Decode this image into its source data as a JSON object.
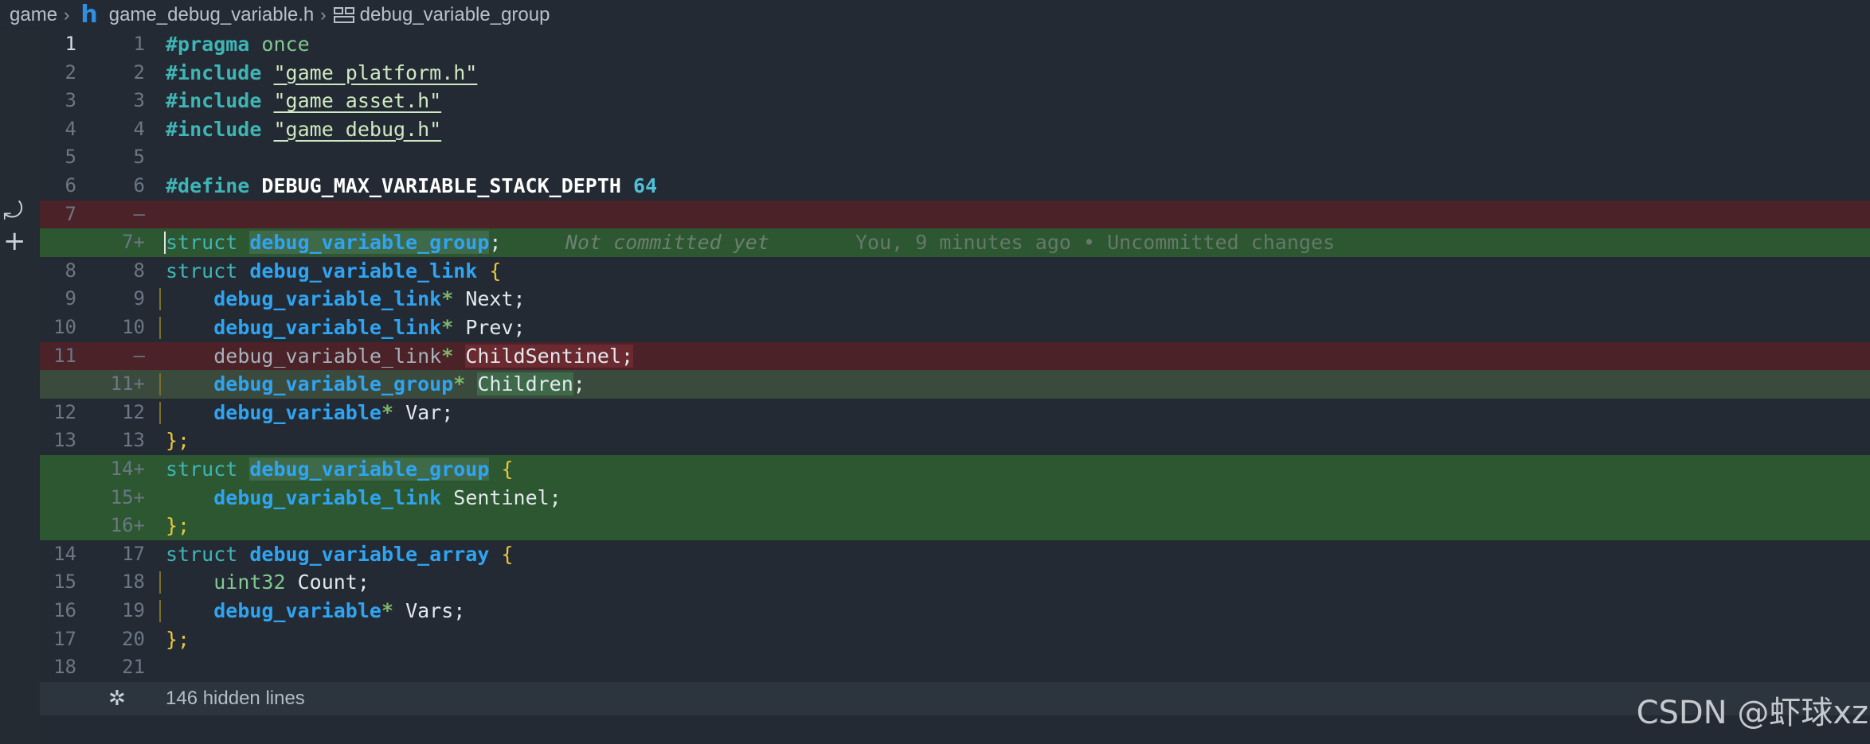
{
  "breadcrumb": {
    "root": "game",
    "file": "game_debug_variable.h",
    "symbol": "debug_variable_group",
    "file_icon": "h-file-icon",
    "symbol_icon": "struct-icon"
  },
  "activity": {
    "icons": [
      "revert-icon",
      "add-icon"
    ]
  },
  "editor": {
    "lines": [
      {
        "old": "1",
        "new": "1",
        "kind": "normal",
        "active": true
      },
      {
        "old": "2",
        "new": "2",
        "kind": "normal"
      },
      {
        "old": "3",
        "new": "3",
        "kind": "normal"
      },
      {
        "old": "4",
        "new": "4",
        "kind": "normal"
      },
      {
        "old": "5",
        "new": "5",
        "kind": "normal"
      },
      {
        "old": "6",
        "new": "6",
        "kind": "normal"
      },
      {
        "old": "7",
        "new": "—",
        "kind": "del"
      },
      {
        "old": "",
        "new": "7+",
        "kind": "add"
      },
      {
        "old": "8",
        "new": "8",
        "kind": "normal"
      },
      {
        "old": "9",
        "new": "9",
        "kind": "normal"
      },
      {
        "old": "10",
        "new": "10",
        "kind": "normal"
      },
      {
        "old": "11",
        "new": "—",
        "kind": "del"
      },
      {
        "old": "",
        "new": "11+",
        "kind": "addsoft"
      },
      {
        "old": "12",
        "new": "12",
        "kind": "normal"
      },
      {
        "old": "13",
        "new": "13",
        "kind": "normal"
      },
      {
        "old": "",
        "new": "14+",
        "kind": "add"
      },
      {
        "old": "",
        "new": "15+",
        "kind": "add"
      },
      {
        "old": "",
        "new": "16+",
        "kind": "add"
      },
      {
        "old": "14",
        "new": "17",
        "kind": "normal"
      },
      {
        "old": "15",
        "new": "18",
        "kind": "normal"
      },
      {
        "old": "16",
        "new": "19",
        "kind": "normal"
      },
      {
        "old": "17",
        "new": "20",
        "kind": "normal"
      },
      {
        "old": "18",
        "new": "21",
        "kind": "normal"
      }
    ],
    "code": {
      "l1_pp": "#pragma",
      "l1_once": "once",
      "include": "#include",
      "l2_str": "\"game_platform.h\"",
      "l3_str": "\"game_asset.h\"",
      "l4_str": "\"game_debug.h\"",
      "define": "#define",
      "l6_macro": "DEBUG_MAX_VARIABLE_STACK_DEPTH",
      "l6_num": "64",
      "struct": "struct",
      "group": "debug_variable_group",
      "link": "debug_variable_link",
      "array": "debug_variable_array",
      "variable": "debug_variable",
      "uint32": "uint32",
      "next": "Next;",
      "prev": "Prev;",
      "child_sentinel": "ChildSentinel;",
      "children": "Children",
      "var": "Var;",
      "sentinel": "Sentinel;",
      "count": "Count;",
      "vars": "Vars;",
      "star": "*",
      "open_brace": "{",
      "close_brace": "};",
      "semicolon": ";"
    },
    "blame": {
      "status": "Not committed yet",
      "info": "You, 9 minutes ago • Uncommitted changes"
    },
    "hidden": {
      "label": "146 hidden lines",
      "icon": "fold-icon"
    }
  },
  "watermark": "CSDN @虾球xz"
}
